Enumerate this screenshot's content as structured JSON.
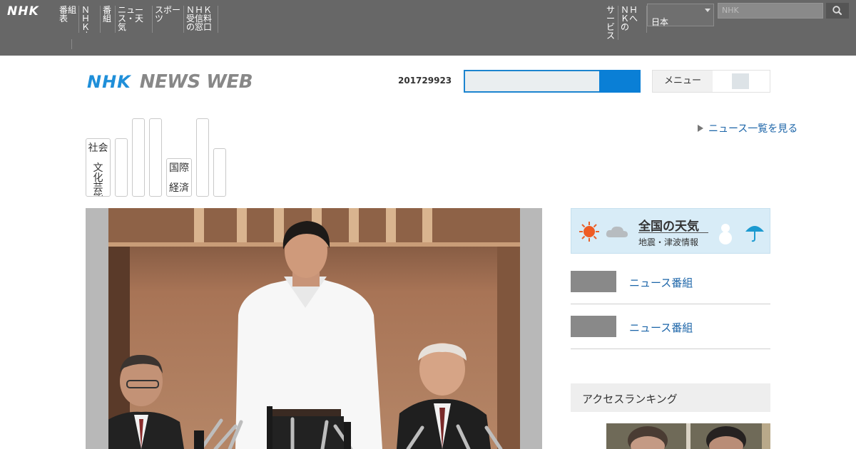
{
  "global_bar": {
    "logo": "NHK",
    "left_nav": [
      "番組表",
      "ＮＨＫオンライン",
      "番組",
      "ニュース・天気",
      "スポーツ",
      "ＮＨＫ受信料の窓口"
    ],
    "right_nav": [
      "サービス",
      "ＮＨＫへの"
    ],
    "language_select": "日本",
    "search_placeholder": "NHK"
  },
  "header": {
    "logo_nhk": "NHK",
    "logo_news_web": "NEWS WEB",
    "date_text": "201729923",
    "menu_label": "メニュー"
  },
  "category_tabs": [
    {
      "lines": [
        "社会",
        "文化芸能"
      ]
    },
    {
      "lines": []
    },
    {
      "lines": []
    },
    {
      "lines": []
    },
    {
      "lines": [
        "国際",
        "経済"
      ]
    },
    {
      "lines": []
    },
    {
      "lines": []
    }
  ],
  "news_list_link": "ニュース一覧を見る",
  "weather_banner": {
    "title": "全国の天気",
    "subtitle": "地震・津波情報"
  },
  "side_items": [
    {
      "label": "ニュース番組"
    },
    {
      "label": "ニュース番組"
    }
  ],
  "ranking_header": "アクセスランキング",
  "icons": {
    "global_search": "search-icon",
    "weather_sun": "sun-icon",
    "weather_cloud": "cloud-icon",
    "weather_snow": "snowman-icon",
    "weather_umbrella": "umbrella-icon"
  },
  "colors": {
    "global_bar": "#676767",
    "brand_blue": "#1f8fd9",
    "link_blue": "#1b64a8",
    "search_blue": "#0a7fd6"
  }
}
